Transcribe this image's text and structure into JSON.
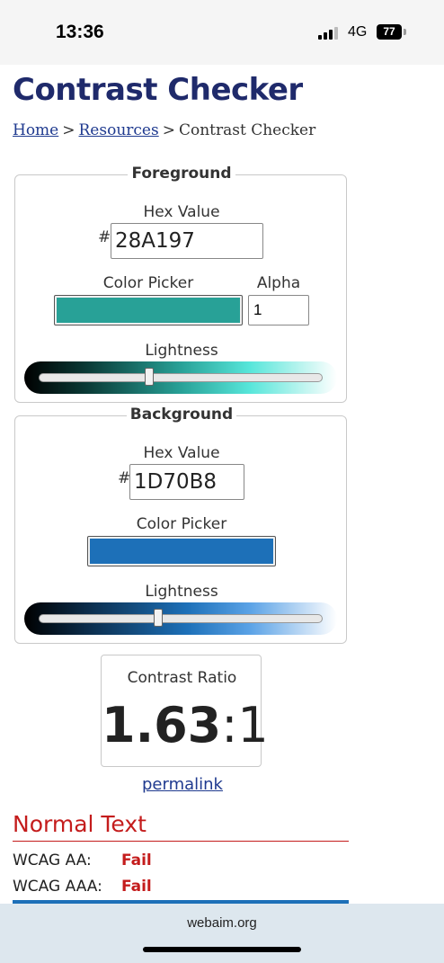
{
  "status_bar": {
    "time": "13:36",
    "network": "4G",
    "battery": "77"
  },
  "page": {
    "title": "Contrast Checker",
    "breadcrumb": {
      "home": "Home",
      "sep1": ">",
      "resources": "Resources",
      "sep2": ">",
      "current": "Contrast Checker"
    }
  },
  "foreground": {
    "legend": "Foreground",
    "hex_label": "Hex Value",
    "hash": "#",
    "hex_value": "28A197",
    "picker_label": "Color Picker",
    "alpha_label": "Alpha",
    "alpha_value": "1",
    "lightness_label": "Lightness",
    "color": "#28A197",
    "lightness_level": 0.39
  },
  "background": {
    "legend": "Background",
    "hex_label": "Hex Value",
    "hash": "#",
    "hex_value": "1D70B8",
    "picker_label": "Color Picker",
    "lightness_label": "Lightness",
    "color": "#1D70B8",
    "lightness_level": 0.42
  },
  "result": {
    "label": "Contrast Ratio",
    "ratio_bold": "1.63",
    "ratio_rest": ":1",
    "permalink": "permalink"
  },
  "normal_text": {
    "title": "Normal Text",
    "rows": [
      {
        "level": "WCAG AA:",
        "result": "Fail"
      },
      {
        "level": "WCAG AAA:",
        "result": "Fail"
      }
    ]
  },
  "browser": {
    "url": "webaim.org"
  },
  "colors": {
    "fail": "#c41c1c",
    "heading": "#1f2a6b",
    "link": "#1f3a8f"
  }
}
